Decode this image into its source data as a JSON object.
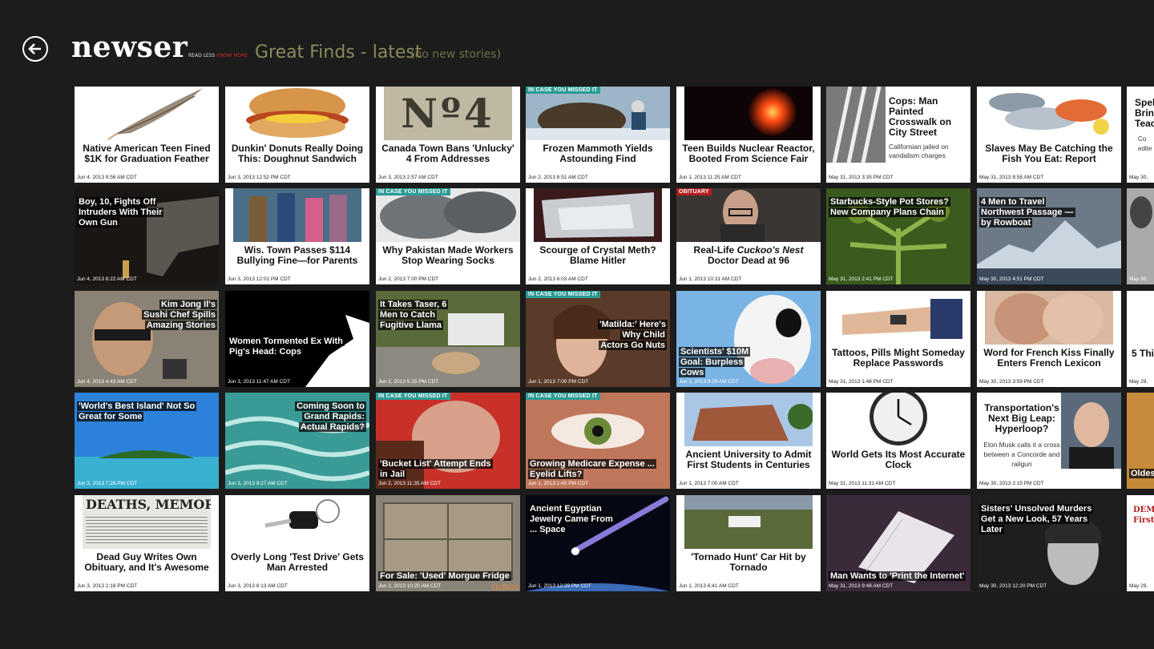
{
  "header": {
    "logo": "newser",
    "tagline_a": "READ LESS",
    "tagline_b": "KNOW MORE",
    "section_title": "Great Finds - latest",
    "section_sub": "(no new stories)"
  },
  "badges": {
    "missed": "IN CASE YOU MISSED IT",
    "obituary": "OBITUARY"
  },
  "tiles": [
    [
      {
        "title": "Native American Teen Fined $1K for Graduation Feather",
        "date": "Jun 4, 2013 9:56 AM CDT"
      },
      {
        "title": "Dunkin' Donuts Really Doing This: Doughnut Sandwich",
        "date": "Jun 3, 2013 12:52 PM CDT"
      },
      {
        "title": "Canada Town Bans 'Unlucky' 4 From Addresses",
        "date": "Jun 3, 2013 2:57 AM CDT",
        "image_text": "Nº4"
      },
      {
        "title": "Frozen Mammoth Yields Astounding Find",
        "date": "Jun 2, 2013 8:51 AM CDT"
      },
      {
        "title": "Teen Builds Nuclear Reactor, Booted From Science Fair",
        "date": "Jun 1, 2013 11:25 AM CDT"
      },
      {
        "title": "Cops: Man Painted Crosswalk on City Street",
        "subtitle": "Californian jailed on vandalism charges",
        "date": "May 31, 2013 3:35 PM CDT"
      },
      {
        "title": "Slaves May Be Catching the Fish You Eat: Report",
        "date": "May 31, 2013 8:58 AM CDT"
      },
      {
        "title": "Spel Bring Teac",
        "subtitle": "Co edite",
        "date": "May 30,"
      }
    ],
    [
      {
        "title": "Boy, 10, Fights Off Intruders With Their Own Gun",
        "date": "Jun 4, 2013 8:22 AM CDT"
      },
      {
        "title": "Wis. Town Passes $114 Bullying Fine—for Parents",
        "date": "Jun 3, 2013 12:01 PM CDT"
      },
      {
        "title": "Why Pakistan Made Workers Stop Wearing Socks",
        "date": "Jun 2, 2013 7:00 PM CDT"
      },
      {
        "title": "Scourge of Crystal Meth? Blame Hitler",
        "date": "Jun 2, 2013 6:03 AM CDT"
      },
      {
        "title_a": "Real-Life ",
        "title_em": "Cuckoo's Nest",
        "title_b": " Doctor Dead at 96",
        "date": "Jun 1, 2013 10:31 AM CDT"
      },
      {
        "title": "Starbucks-Style Pot Stores? New Company Plans Chain",
        "date": "May 31, 2013 2:41 PM CDT"
      },
      {
        "title": "4 Men to Travel Northwest Passage —by Rowboat",
        "date": "May 30, 2013 4:51 PM CDT"
      },
      {
        "title": "",
        "date": "May 30,"
      }
    ],
    [
      {
        "title": "Kim Jong Il's Sushi Chef Spills Amazing Stories",
        "date": "Jun 4, 2013 4:43 AM CDT"
      },
      {
        "title": "Women Tormented Ex With Pig's Head: Cops",
        "date": "Jun 3, 2013 11:47 AM CDT"
      },
      {
        "title": "It Takes Taser, 6 Men to Catch Fugitive Llama",
        "date": "Jun 2, 2013 5:15 PM CDT"
      },
      {
        "title": "'Matilda:' Here's Why Child Actors Go Nuts",
        "date": "Jun 1, 2013 7:00 PM CDT"
      },
      {
        "title": "Scientists' $10M Goal: Burpless Cows",
        "date": "Jun 1, 2013 8:29 AM CDT"
      },
      {
        "title": "Tattoos, Pills Might Someday Replace Passwords",
        "date": "May 31, 2013 1:48 PM CDT"
      },
      {
        "title": "Word for French Kiss Finally Enters French Lexicon",
        "date": "May 30, 2013 3:59 PM CDT"
      },
      {
        "title": "5 Thi",
        "date": "May 29,"
      }
    ],
    [
      {
        "title": "'World's Best Island' Not So Great for Some",
        "date": "Jun 3, 2013 7:26 PM CDT"
      },
      {
        "title": "Coming Soon to Grand Rapids: Actual Rapids?",
        "date": "Jun 3, 2013 9:27 AM CDT"
      },
      {
        "title": "'Bucket List' Attempt Ends in Jail",
        "date": "Jun 2, 2013 11:35 AM CDT"
      },
      {
        "title": "Growing Medicare Expense ... Eyelid Lifts?",
        "date": "Jun 1, 2013 1:45 PM CDT"
      },
      {
        "title": "Ancient University to Admit First Students in Centuries",
        "date": "Jun 1, 2013 7:00 AM CDT"
      },
      {
        "title": "World Gets Its Most Accurate Clock",
        "date": "May 31, 2013 11:31 AM CDT"
      },
      {
        "title": "Transportation's Next Big Leap: Hyperloop?",
        "subtitle": "Elon Musk calls it a cross between a Concorde and railgun",
        "date": "May 30, 2013 2:15 PM CDT"
      },
      {
        "title": "Oldes",
        "date": ""
      }
    ],
    [
      {
        "title": "Dead Guy Writes Own Obituary, and It's Awesome",
        "date": "Jun 3, 2013 2:18 PM CDT",
        "image_text": "DEATHS, MEMORI"
      },
      {
        "title": "Overly Long 'Test Drive' Gets Man Arrested",
        "date": "Jun 3, 2013 8:13 AM CDT"
      },
      {
        "title": "For Sale: 'Used' Morgue Fridge",
        "date": "Jun 2, 2013 10:20 AM CDT",
        "image_text": "11/28/20"
      },
      {
        "title": "Ancient Egyptian Jewelry Came From ... Space",
        "date": "Jun 1, 2013 12:29 PM CDT"
      },
      {
        "title": "'Tornado Hunt' Car Hit by Tornado",
        "date": "Jun 1, 2013 6:41 AM CDT"
      },
      {
        "title": "Man Wants to 'Print the Internet'",
        "date": "May 31, 2013 9:48 AM CDT"
      },
      {
        "title": "Sisters' Unsolved Murders Get a New Look, 57 Years Later",
        "date": "May 30, 2013 12:20 PM CDT"
      },
      {
        "title": "DEM First",
        "date": "May 29,"
      }
    ]
  ]
}
